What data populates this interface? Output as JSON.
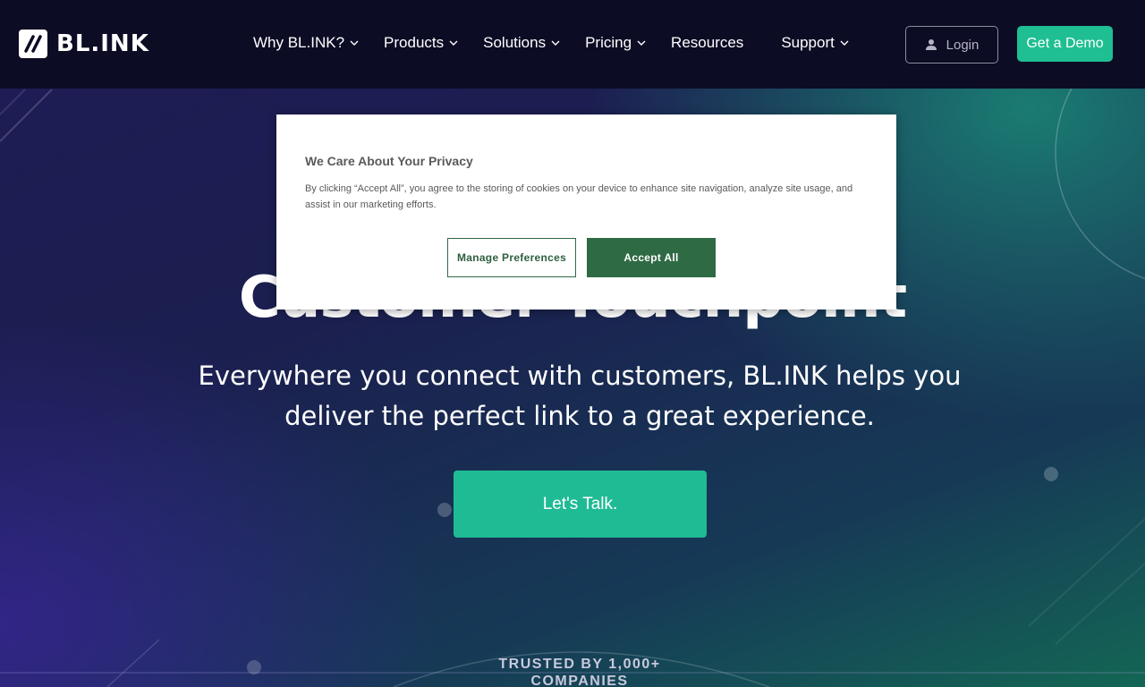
{
  "brand": {
    "name": "BL.INK"
  },
  "nav": {
    "items": [
      {
        "label": "Why BL.INK?",
        "has_dropdown": true
      },
      {
        "label": "Products",
        "has_dropdown": true
      },
      {
        "label": "Solutions",
        "has_dropdown": true
      },
      {
        "label": "Pricing",
        "has_dropdown": true
      },
      {
        "label": "Resources",
        "has_dropdown": false
      },
      {
        "label": "Support",
        "has_dropdown": true
      }
    ],
    "login_label": "Login",
    "demo_label": "Get a Demo"
  },
  "hero": {
    "headline": "Customer Touchpoint",
    "subtext": "Everywhere you connect with customers, BL.INK helps you deliver the perfect link to a great experience.",
    "cta_label": "Let's Talk.",
    "trusted_label": "TRUSTED BY 1,000+ COMPANIES"
  },
  "cookie_modal": {
    "title": "We Care About Your Privacy",
    "body": "By clicking “Accept All”, you agree to the storing of cookies on your device to enhance site navigation, analyze site usage, and assist in our marketing efforts.",
    "manage_label": "Manage Preferences",
    "accept_label": "Accept All"
  },
  "colors": {
    "nav_bg": "#0d0c25",
    "accent_green": "#1fbf93",
    "modal_button_green": "#2e6a43"
  }
}
